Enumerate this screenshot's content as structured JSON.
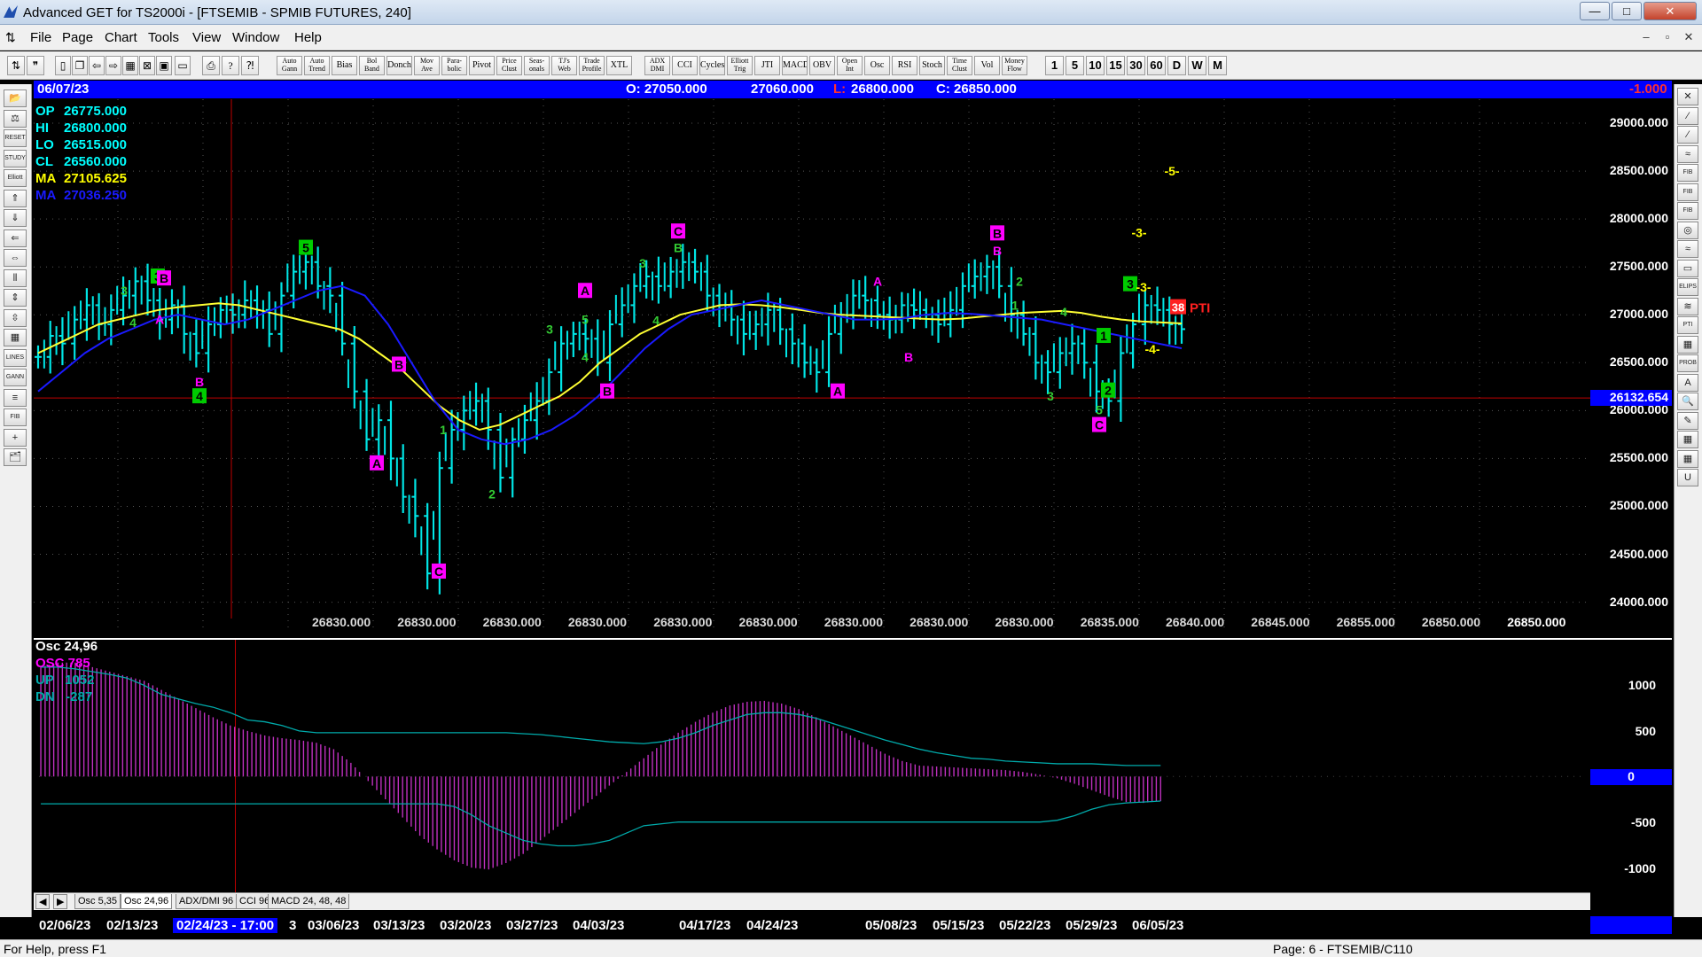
{
  "window": {
    "title": "Advanced GET for TS2000i - [FTSEMIB - SPMIB FUTURES, 240]",
    "min": "—",
    "max": "□",
    "close": "✕"
  },
  "menu": [
    "File",
    "Page",
    "Chart",
    "Tools",
    "View",
    "Window",
    "Help"
  ],
  "toolbar": {
    "studies": [
      [
        "Auto",
        "Gann"
      ],
      [
        "Auto",
        "Trend"
      ],
      [
        "Bias",
        ""
      ],
      [
        "Bol",
        "Band"
      ],
      [
        "Donch",
        ""
      ],
      [
        "Mov",
        "Ave"
      ],
      [
        "Para-",
        "bolic"
      ],
      [
        "Pivot",
        ""
      ],
      [
        "Price",
        "Clust"
      ],
      [
        "Seas-",
        "onals"
      ],
      [
        "TJ's",
        "Web"
      ],
      [
        "Trade",
        "Profile"
      ],
      [
        "XTL",
        ""
      ],
      [
        "ADX",
        "DMI"
      ],
      [
        "CCI",
        ""
      ],
      [
        "Cycles",
        ""
      ],
      [
        "Elliott",
        "Trig"
      ],
      [
        "JTI",
        ""
      ],
      [
        "MACD",
        ""
      ],
      [
        "OBV",
        ""
      ],
      [
        "Open",
        "Int"
      ],
      [
        "Osc",
        ""
      ],
      [
        "RSI",
        ""
      ],
      [
        "Stoch",
        ""
      ],
      [
        "Time",
        "Clust"
      ],
      [
        "Vol",
        ""
      ],
      [
        "Money",
        "Flow"
      ]
    ],
    "intervals": [
      "1",
      "5",
      "10",
      "15",
      "30",
      "60",
      "D",
      "W",
      "M"
    ]
  },
  "left_tools": [
    "📂",
    "⚖",
    "RESET",
    "STUDY",
    "Elliott",
    "⇑",
    "⇓",
    "⇐",
    "⇔",
    "⫴",
    "⇕",
    "⇳",
    "▦",
    "LINES",
    "GANN",
    "≡",
    "FIB",
    "+",
    "🗂"
  ],
  "right_tools": [
    "✕",
    "⁄",
    "⁄",
    "≈",
    "FIB RET",
    "FIB EXT",
    "FIB TIME",
    "◎",
    "≈",
    "▭",
    "ELIPS",
    "≋",
    "PTI",
    "▦",
    "PROB",
    "A",
    "🔍",
    "✎",
    "▦",
    "▦",
    "U"
  ],
  "infobar": {
    "date": "06/07/23",
    "open": "O: 27050.000",
    "high": "27060.000",
    "low_label": "L:",
    "low": "26800.000",
    "close": "C: 26850.000",
    "change": "-1.000"
  },
  "readouts": [
    {
      "label": "OP",
      "value": "26775.000",
      "color": "#00ffff"
    },
    {
      "label": "HI",
      "value": "26800.000",
      "color": "#00ffff"
    },
    {
      "label": "LO",
      "value": "26515.000",
      "color": "#00ffff"
    },
    {
      "label": "CL",
      "value": "26560.000",
      "color": "#00ffff"
    },
    {
      "label": "MA",
      "value": "27105.625",
      "color": "#ffff00"
    },
    {
      "label": "MA",
      "value": "27036.250",
      "color": "#1a1aff"
    }
  ],
  "price_axis": {
    "ticks": [
      "29000.000",
      "28500.000",
      "28000.000",
      "27500.000",
      "27000.000",
      "26500.000",
      "26000.000",
      "25500.000",
      "25000.000",
      "24500.000",
      "24000.000"
    ],
    "current": "26132.654",
    "ymin": 23700,
    "ymax": 29250
  },
  "bottom_values": [
    "26830.000",
    "26830.000",
    "26830.000",
    "26830.000",
    "26830.000",
    "26830.000",
    "26830.000",
    "26830.000",
    "26830.000",
    "26835.000",
    "26840.000",
    "26845.000",
    "26855.000",
    "26850.000",
    "26850.000"
  ],
  "chart_data": {
    "type": "line",
    "series": [
      {
        "values": [
          26560,
          26780,
          26700,
          26950,
          27100,
          26900,
          27050,
          27200,
          27350,
          27150,
          26950,
          27100,
          26800,
          26600,
          26900,
          27050,
          27000,
          27150,
          27050,
          26800,
          27200,
          27450,
          27550,
          27300,
          27200,
          26700,
          26200,
          25700,
          25900,
          25500,
          25100,
          24900,
          24300,
          25400,
          25800,
          26000,
          26100,
          25800,
          25300,
          25700,
          25900,
          26100,
          26400,
          26700,
          26800,
          26750,
          26500,
          26900,
          27100,
          27300,
          27400,
          27300,
          27450,
          27550,
          27450,
          27200,
          27100,
          26950,
          26800,
          26900,
          27050,
          26850,
          26700,
          26500,
          26400,
          26800,
          27000,
          27200,
          27150,
          27000,
          26950,
          27100,
          27050,
          27000,
          26900,
          27050,
          27300,
          27400,
          27500,
          27300,
          27000,
          26800,
          26500,
          26400,
          26600,
          26700,
          26500,
          26200,
          26100,
          26600,
          26900,
          27100,
          27050,
          26900,
          26850
        ]
      },
      {
        "values": [
          26600,
          26700,
          26800,
          26900,
          26950,
          27000,
          27050,
          27080,
          27100,
          27120,
          27100,
          27050,
          27000,
          26950,
          26900,
          26850,
          26750,
          26600,
          26450,
          26250,
          26050,
          25900,
          25800,
          25850,
          25950,
          26050,
          26150,
          26300,
          26500,
          26650,
          26800,
          26900,
          27000,
          27050,
          27100,
          27110,
          27100,
          27080,
          27050,
          27020,
          27000,
          26990,
          26980,
          26970,
          26960,
          26950,
          26960,
          26980,
          27000,
          27020,
          27030,
          27040,
          27020,
          26980,
          26950,
          26930,
          26920,
          26910
        ]
      },
      {
        "values": [
          26200,
          26400,
          26600,
          26750,
          26850,
          26950,
          27000,
          26950,
          26900,
          26950,
          27050,
          27150,
          27250,
          27300,
          27200,
          26900,
          26500,
          26100,
          25800,
          25700,
          25650,
          25700,
          25800,
          25950,
          26150,
          26400,
          26650,
          26850,
          27000,
          27050,
          27100,
          27150,
          27100,
          27050,
          27000,
          26950,
          26950,
          26960,
          27000,
          27020,
          27010,
          26990,
          26970,
          26950,
          26900,
          26850,
          26800,
          26750,
          26700,
          26650
        ]
      }
    ]
  },
  "wave_labels": [
    {
      "t": "3",
      "kind": "box",
      "c": "#00cc00",
      "x": 178,
      "y": 27400
    },
    {
      "t": "B",
      "kind": "box",
      "c": "#ff00ff",
      "x": 185,
      "y": 27380
    },
    {
      "t": "3",
      "kind": "txt",
      "c": "#33cc33",
      "x": 140,
      "y": 27250
    },
    {
      "t": "A",
      "kind": "txt",
      "c": "#ff00ff",
      "x": 180,
      "y": 26950
    },
    {
      "t": "4",
      "kind": "txt",
      "c": "#33cc33",
      "x": 150,
      "y": 26920
    },
    {
      "t": "B",
      "kind": "txt",
      "c": "#ff00ff",
      "x": 225,
      "y": 26300
    },
    {
      "t": "4",
      "kind": "box",
      "c": "#00cc00",
      "x": 225,
      "y": 26150
    },
    {
      "t": "5",
      "kind": "box",
      "c": "#00cc00",
      "x": 345,
      "y": 27700
    },
    {
      "t": "B",
      "kind": "box",
      "c": "#ff00ff",
      "x": 450,
      "y": 26480
    },
    {
      "t": "A",
      "kind": "box",
      "c": "#ff00ff",
      "x": 425,
      "y": 25450
    },
    {
      "t": "1",
      "kind": "txt",
      "c": "#33cc33",
      "x": 500,
      "y": 25800
    },
    {
      "t": "C",
      "kind": "box",
      "c": "#ff00ff",
      "x": 495,
      "y": 24320
    },
    {
      "t": "2",
      "kind": "txt",
      "c": "#33cc33",
      "x": 555,
      "y": 25130
    },
    {
      "t": "3",
      "kind": "txt",
      "c": "#33cc33",
      "x": 620,
      "y": 26850
    },
    {
      "t": "A",
      "kind": "box",
      "c": "#ff00ff",
      "x": 660,
      "y": 27250
    },
    {
      "t": "5",
      "kind": "txt",
      "c": "#33cc33",
      "x": 660,
      "y": 26950
    },
    {
      "t": "4",
      "kind": "txt",
      "c": "#33cc33",
      "x": 660,
      "y": 26560
    },
    {
      "t": "B",
      "kind": "box",
      "c": "#ff00ff",
      "x": 685,
      "y": 26200
    },
    {
      "t": "3",
      "kind": "txt",
      "c": "#33cc33",
      "x": 725,
      "y": 27540
    },
    {
      "t": "4",
      "kind": "txt",
      "c": "#33cc33",
      "x": 740,
      "y": 26940
    },
    {
      "t": "C",
      "kind": "box",
      "c": "#ff00ff",
      "x": 765,
      "y": 27870
    },
    {
      "t": "B",
      "kind": "txt",
      "c": "#33cc33",
      "x": 765,
      "y": 27700
    },
    {
      "t": "A",
      "kind": "txt",
      "c": "#ff00ff",
      "x": 990,
      "y": 27350
    },
    {
      "t": "B",
      "kind": "txt",
      "c": "#ff00ff",
      "x": 1025,
      "y": 26560
    },
    {
      "t": "A",
      "kind": "box",
      "c": "#ff00ff",
      "x": 945,
      "y": 26200
    },
    {
      "t": "B",
      "kind": "box",
      "c": "#ff00ff",
      "x": 1125,
      "y": 27850
    },
    {
      "t": "B",
      "kind": "txt",
      "c": "#ff00ff",
      "x": 1125,
      "y": 27670
    },
    {
      "t": "2",
      "kind": "txt",
      "c": "#33cc33",
      "x": 1150,
      "y": 27350
    },
    {
      "t": "1",
      "kind": "txt",
      "c": "#33cc33",
      "x": 1145,
      "y": 27100
    },
    {
      "t": "4",
      "kind": "txt",
      "c": "#33cc33",
      "x": 1200,
      "y": 27030
    },
    {
      "t": "3",
      "kind": "txt",
      "c": "#33cc33",
      "x": 1185,
      "y": 26150
    },
    {
      "t": "1",
      "kind": "box",
      "c": "#00cc00",
      "x": 1245,
      "y": 26780
    },
    {
      "t": "2",
      "kind": "box",
      "c": "#00cc00",
      "x": 1250,
      "y": 26210
    },
    {
      "t": "5",
      "kind": "txt",
      "c": "#33cc33",
      "x": 1240,
      "y": 26010
    },
    {
      "t": "C",
      "kind": "box",
      "c": "#ff00ff",
      "x": 1240,
      "y": 25850
    },
    {
      "t": "3",
      "kind": "box",
      "c": "#00cc00",
      "x": 1275,
      "y": 27320
    },
    {
      "t": "-3-",
      "kind": "txt",
      "c": "#ffff00",
      "x": 1290,
      "y": 27290
    },
    {
      "t": "-4-",
      "kind": "txt",
      "c": "#ffff00",
      "x": 1300,
      "y": 26640
    },
    {
      "t": "-3-",
      "kind": "txt",
      "c": "#ffff00",
      "x": 1285,
      "y": 27860
    },
    {
      "t": "-5-",
      "kind": "txt",
      "c": "#ffff00",
      "x": 1322,
      "y": 28500
    }
  ],
  "pti": {
    "value": "38",
    "label": "PTI"
  },
  "osc": {
    "labels": [
      {
        "label": "Osc 24,96",
        "color": "#ffffff"
      },
      {
        "label": "OSC 785",
        "color": "#ff00ff"
      },
      {
        "label": "UP   1052",
        "color": "#00aaaa"
      },
      {
        "label": "DN   -287",
        "color": "#00aaaa"
      }
    ],
    "ticks": [
      "1000",
      "500",
      "0",
      "-500",
      "-1000"
    ],
    "current": "0",
    "values": [
      1200,
      1250,
      1250,
      1200,
      1150,
      1100,
      1050,
      950,
      850,
      750,
      650,
      560,
      500,
      450,
      420,
      400,
      370,
      300,
      150,
      -50,
      -250,
      -450,
      -650,
      -800,
      -920,
      -1000,
      -1020,
      -950,
      -850,
      -700,
      -550,
      -400,
      -250,
      -100,
      50,
      200,
      350,
      480,
      600,
      700,
      780,
      820,
      830,
      800,
      740,
      650,
      550,
      450,
      350,
      250,
      170,
      120,
      110,
      100,
      90,
      80,
      70,
      50,
      20,
      -20,
      -80,
      -150,
      -220,
      -280,
      -290,
      -270
    ]
  },
  "tabs": [
    "Osc 5,35",
    "Osc 24,96",
    "ADX/DMI 96",
    "CCI 96",
    "MACD 24, 48, 48"
  ],
  "dates": [
    "02/06/23",
    "02/13/23",
    "02/24/23 - 17:00",
    "3",
    "03/06/23",
    "03/13/23",
    "03/20/23",
    "03/27/23",
    "04/03/23",
    "04/17/23",
    "04/24/23",
    "05/08/23",
    "05/15/23",
    "05/22/23",
    "05/29/23",
    "06/05/23"
  ],
  "status": {
    "help": "For Help, press F1",
    "page": "Page: 6 - FTSEMIB/C110"
  }
}
